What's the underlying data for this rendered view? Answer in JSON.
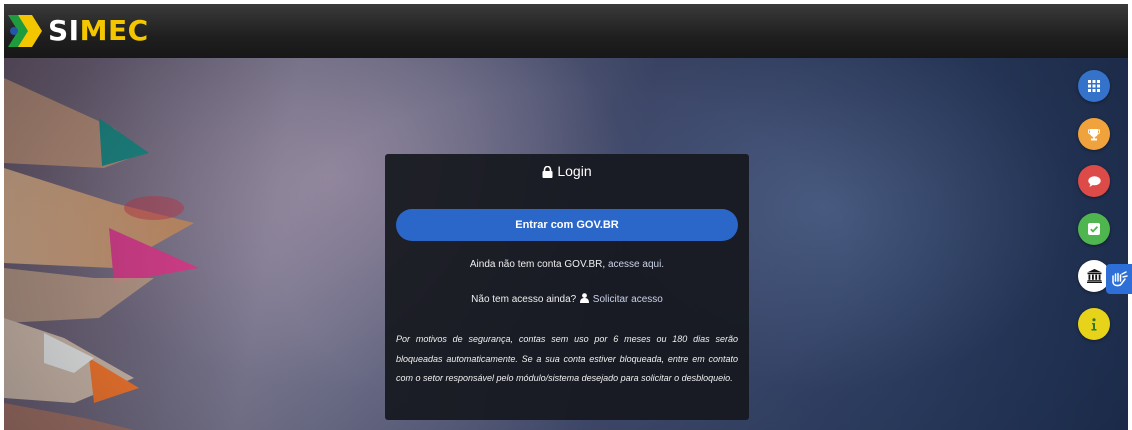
{
  "header": {
    "logo_part1": "SI",
    "logo_part2": "MEC"
  },
  "login": {
    "title": "Login",
    "gov_button": "Entrar com  GOV.BR",
    "no_account_text": "Ainda não tem conta GOV.BR,",
    "no_account_link": "acesse aqui.",
    "no_access_text": "Não tem acesso ainda?",
    "request_access_link": "Solicitar acesso",
    "notice": "Por motivos de segurança, contas sem uso por 6 meses ou 180 dias serão bloqueadas automaticamente. Se a sua conta estiver bloqueada, entre em contato com o setor responsável pelo módulo/sistema desejado para solicitar o desbloqueio."
  },
  "side_buttons": [
    {
      "icon": "grid-icon",
      "color": "#3473c9"
    },
    {
      "icon": "trophy-icon",
      "color": "#f0a33c"
    },
    {
      "icon": "chat-icon",
      "color": "#dd4b48"
    },
    {
      "icon": "checkbox-icon",
      "color": "#4fb54e"
    },
    {
      "icon": "institution-icon",
      "color": "#ffffff"
    },
    {
      "icon": "info-icon",
      "color": "#e7d41a"
    }
  ],
  "accessibility": {
    "icon": "sign-language-icon",
    "color": "#2d6fd6"
  }
}
